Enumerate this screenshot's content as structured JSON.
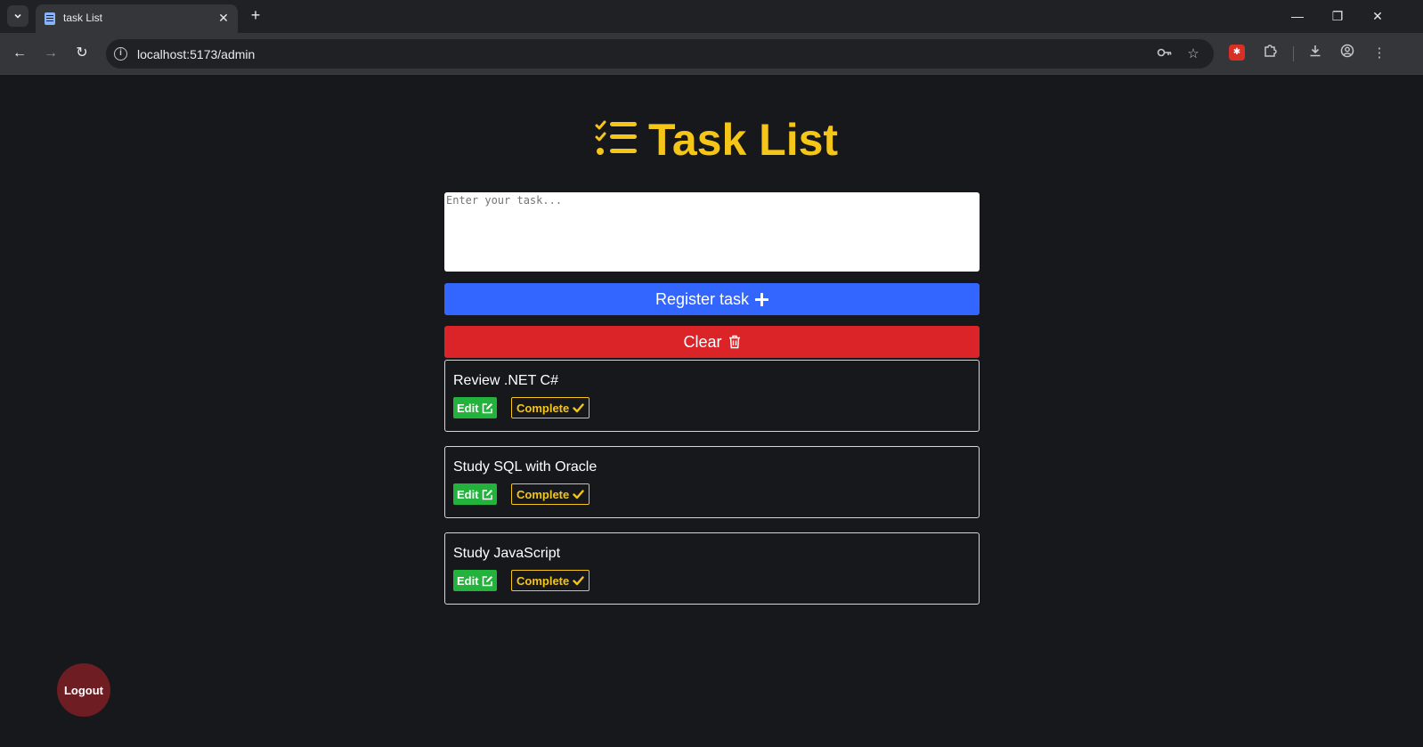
{
  "browser": {
    "tab_title": "task List",
    "tab_close": "✕",
    "new_tab": "+",
    "url": "localhost:5173/admin",
    "window_controls": {
      "minimize": "—",
      "restore": "❐",
      "close": "✕"
    },
    "nav": {
      "back": "←",
      "forward": "→",
      "reload": "↻"
    }
  },
  "app": {
    "title": "Task List",
    "accent_color": "#f5c518",
    "input_placeholder": "Enter your task...",
    "register_label": "Register task",
    "clear_label": "Clear",
    "edit_label": "Edit",
    "complete_label": "Complete",
    "logout_label": "Logout",
    "tasks": [
      {
        "text": "Review .NET C#"
      },
      {
        "text": "Study SQL with Oracle"
      },
      {
        "text": "Study JavaScript"
      }
    ]
  }
}
